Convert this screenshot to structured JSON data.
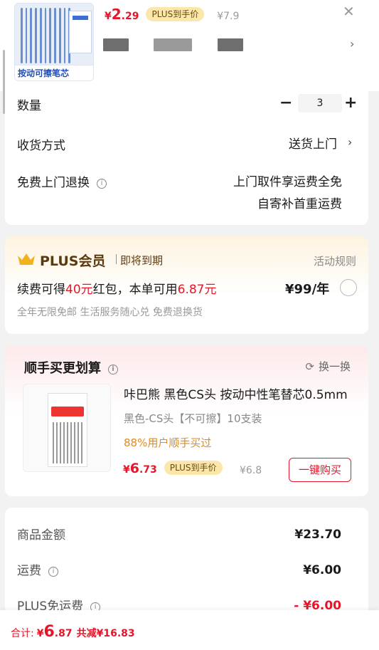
{
  "product": {
    "image_caption": "按动可擦笔芯",
    "price_currency": "¥",
    "price_int": "2",
    "price_dec": ".29",
    "plus_tag": "PLUS到手价",
    "original_price": "¥7.9"
  },
  "options": {
    "qty_label": "数量",
    "qty_minus": "−",
    "qty_value": "3",
    "qty_plus": "+",
    "shipping_label": "收货方式",
    "shipping_value": "送货上门",
    "return_label": "免费上门退换",
    "return_line1": "上门取件享运费全免",
    "return_line2": "自寄补首重运费"
  },
  "plus": {
    "title": "PLUS会员",
    "status": "即将到期",
    "rules": "活动规则",
    "line_a": "续费可得",
    "line_b": "40元",
    "line_c": "红包，本单可用",
    "line_d": "6.87元",
    "price": "¥99/年",
    "perks": "全年无限免邮 生活服务随心兑 免费退换货"
  },
  "addon": {
    "title": "顺手买更划算",
    "refresh": "换一换",
    "name": "咔巴熊 黑色CS头 按动中性笔替芯0.5mm",
    "spec": "黑色-CS头【不可擦】10支装",
    "stat": "88%用户顺手买过",
    "price_currency": "¥",
    "price_int": "6",
    "price_dec": ".73",
    "plus_tag": "PLUS到手价",
    "original_price": "¥6.8",
    "buy": "一键购买"
  },
  "summary": {
    "goods_label": "商品金额",
    "goods_value": "¥23.70",
    "freight_label": "运费",
    "freight_value": "¥6.00",
    "plus_free_label": "PLUS免运费",
    "plus_free_value": "- ¥6.00"
  },
  "footer": {
    "total_label": "合计:",
    "currency": "¥",
    "int": "6",
    "dec": ".87",
    "saved": "共减¥16.83"
  },
  "colors": {
    "accent_red": "#e5162a",
    "plus_gold": "#fbe7a9",
    "plus_brown": "#5b3a10"
  }
}
